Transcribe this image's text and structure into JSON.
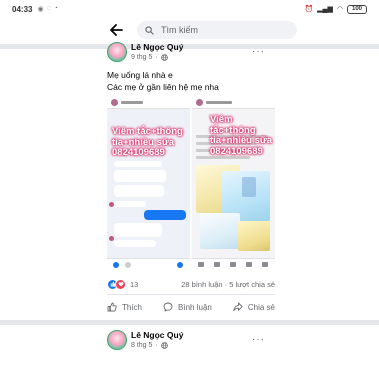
{
  "status_bar": {
    "time": "04:33",
    "battery": "100"
  },
  "header": {
    "search_placeholder": "Tìm kiếm"
  },
  "post": {
    "author": "Lê Ngọc Quý",
    "time": "9 thg 5",
    "text_line1": "Mẹ uống lá nhà e",
    "text_line2": "Các mẹ ở gần liên hệ mẹ nha",
    "image1_overlay_line1": "Viêm tắc+thông",
    "image1_overlay_line2": "tia+nhiều sữa",
    "image1_overlay_line3": "0824109689",
    "image2_overlay_line1": "Viêm tắc+thông",
    "image2_overlay_line2": "tia+nhiều sữa",
    "image2_overlay_line3": "0824109689",
    "reaction_count": "13",
    "comments_shares": "28 bình luận · 5 lượt chia sẻ",
    "like_label": "Thích",
    "comment_label": "Bình luận",
    "share_label": "Chia sẻ"
  },
  "post2": {
    "author": "Lê Ngọc Quý",
    "time": "8 thg 5"
  },
  "colors": {
    "accent": "#1877f2",
    "love": "#f33e58",
    "overlay_glow": "#e0245e"
  }
}
